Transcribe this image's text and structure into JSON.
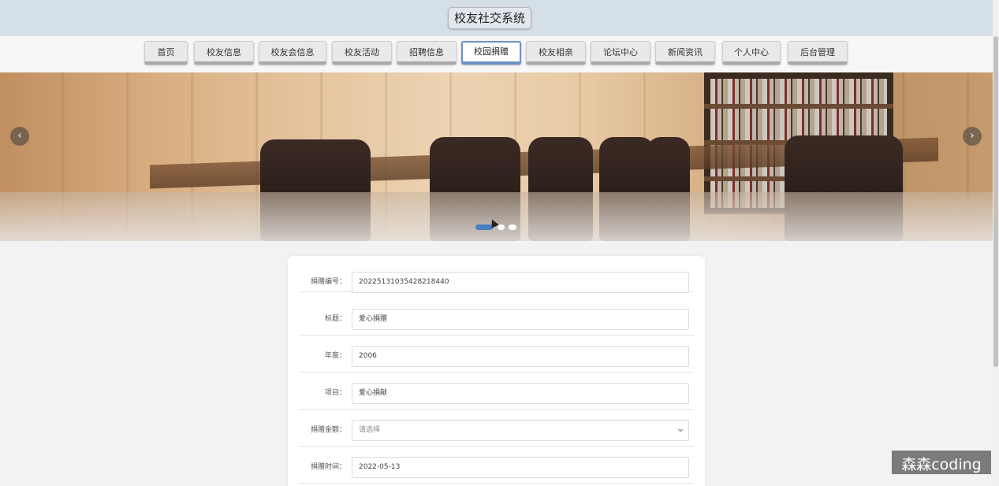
{
  "header": {
    "title": "校友社交系统"
  },
  "nav": {
    "items": [
      {
        "label": "首页"
      },
      {
        "label": "校友信息"
      },
      {
        "label": "校友会信息"
      },
      {
        "label": "校友活动"
      },
      {
        "label": "招聘信息"
      },
      {
        "label": "校园捐赠"
      },
      {
        "label": "校友相亲"
      },
      {
        "label": "论坛中心"
      },
      {
        "label": "新闻资讯"
      },
      {
        "label": "个人中心"
      },
      {
        "label": "后台管理"
      }
    ],
    "active_index": 5
  },
  "carousel": {
    "prev_icon": "chevron-left-icon",
    "next_icon": "chevron-right-icon",
    "prev_glyph": "‹",
    "next_glyph": "›",
    "slide_count": 3,
    "active_slide": 1
  },
  "form": {
    "fields": [
      {
        "label": "捐赠编号：",
        "value": "20225131035428218440"
      },
      {
        "label": "标题：",
        "value": "爱心捐赠"
      },
      {
        "label": "年度：",
        "value": "2006"
      },
      {
        "label": "项目：",
        "value": "爱心捐献"
      },
      {
        "label": "捐赠金额：",
        "value": "请选择"
      },
      {
        "label": "捐赠时间：",
        "value": "2022-05-13"
      }
    ]
  },
  "watermark": {
    "text": "森森coding"
  },
  "colors": {
    "accent": "#6c93c4",
    "header_bg": "#d5dfe8",
    "dot_active": "#4a7fc1"
  }
}
